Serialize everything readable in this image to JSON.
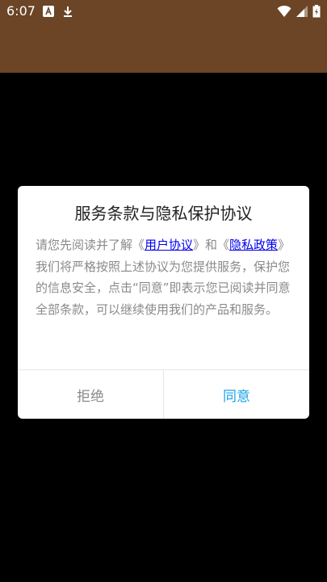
{
  "status_bar": {
    "time": "6:07",
    "icons": [
      "notification-a-icon",
      "download-icon",
      "wifi-icon",
      "signal-icon",
      "battery-charging-icon"
    ],
    "colors": {
      "background": "#6b4526"
    }
  },
  "dialog": {
    "title": "服务条款与隐私保护协议",
    "body": {
      "prefix": "请您先阅读并了解《",
      "user_agreement_link": "用户协议",
      "middle": "》和《",
      "privacy_policy_link": "隐私政策",
      "suffix": "》我们将严格按照上述协议为您提供服务，保护您的信息安全，点击“同意”即表示您已阅读并同意全部条款，可以继续使用我们的产品和服务。"
    },
    "buttons": {
      "refuse": "拒绝",
      "agree": "同意"
    },
    "colors": {
      "agree": "#1aa3e8",
      "link": "#0000ee",
      "refuse": "#8a8a8a"
    }
  }
}
